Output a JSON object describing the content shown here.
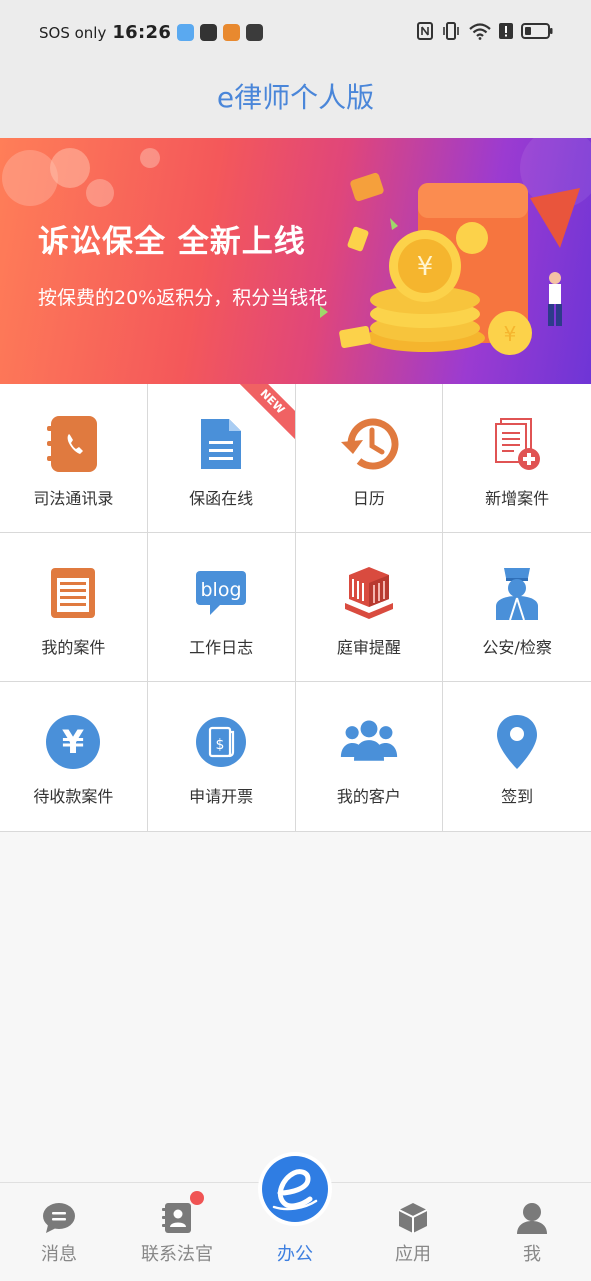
{
  "status_bar": {
    "carrier": "SOS only",
    "time": "16:26"
  },
  "header": {
    "title": "e律师个人版"
  },
  "banner": {
    "headline": "诉讼保全 全新上线",
    "subline": "按保费的20%返积分，积分当钱花"
  },
  "grid": {
    "items": [
      {
        "label": "司法通讯录",
        "icon": "address-book-icon"
      },
      {
        "label": "保函在线",
        "icon": "document-icon",
        "badge": "NEW"
      },
      {
        "label": "日历",
        "icon": "history-clock-icon"
      },
      {
        "label": "新增案件",
        "icon": "add-document-icon"
      },
      {
        "label": "我的案件",
        "icon": "case-list-icon"
      },
      {
        "label": "工作日志",
        "icon": "blog-icon",
        "icon_text": "blog"
      },
      {
        "label": "庭审提醒",
        "icon": "courthouse-icon"
      },
      {
        "label": "公安/检察",
        "icon": "police-officer-icon"
      },
      {
        "label": "待收款案件",
        "icon": "yen-icon",
        "icon_text": "¥"
      },
      {
        "label": "申请开票",
        "icon": "invoice-icon"
      },
      {
        "label": "我的客户",
        "icon": "clients-icon"
      },
      {
        "label": "签到",
        "icon": "location-pin-icon"
      }
    ]
  },
  "bottom_nav": {
    "items": [
      {
        "label": "消息",
        "icon": "message-icon"
      },
      {
        "label": "联系法官",
        "icon": "contact-judge-icon"
      },
      {
        "label": "办公",
        "icon": "e-logo-icon",
        "active": true
      },
      {
        "label": "应用",
        "icon": "cube-icon"
      },
      {
        "label": "我",
        "icon": "person-icon"
      }
    ]
  },
  "colors": {
    "accent": "#3e7fe0",
    "title": "#4a86d9",
    "badge": "#f05454"
  }
}
